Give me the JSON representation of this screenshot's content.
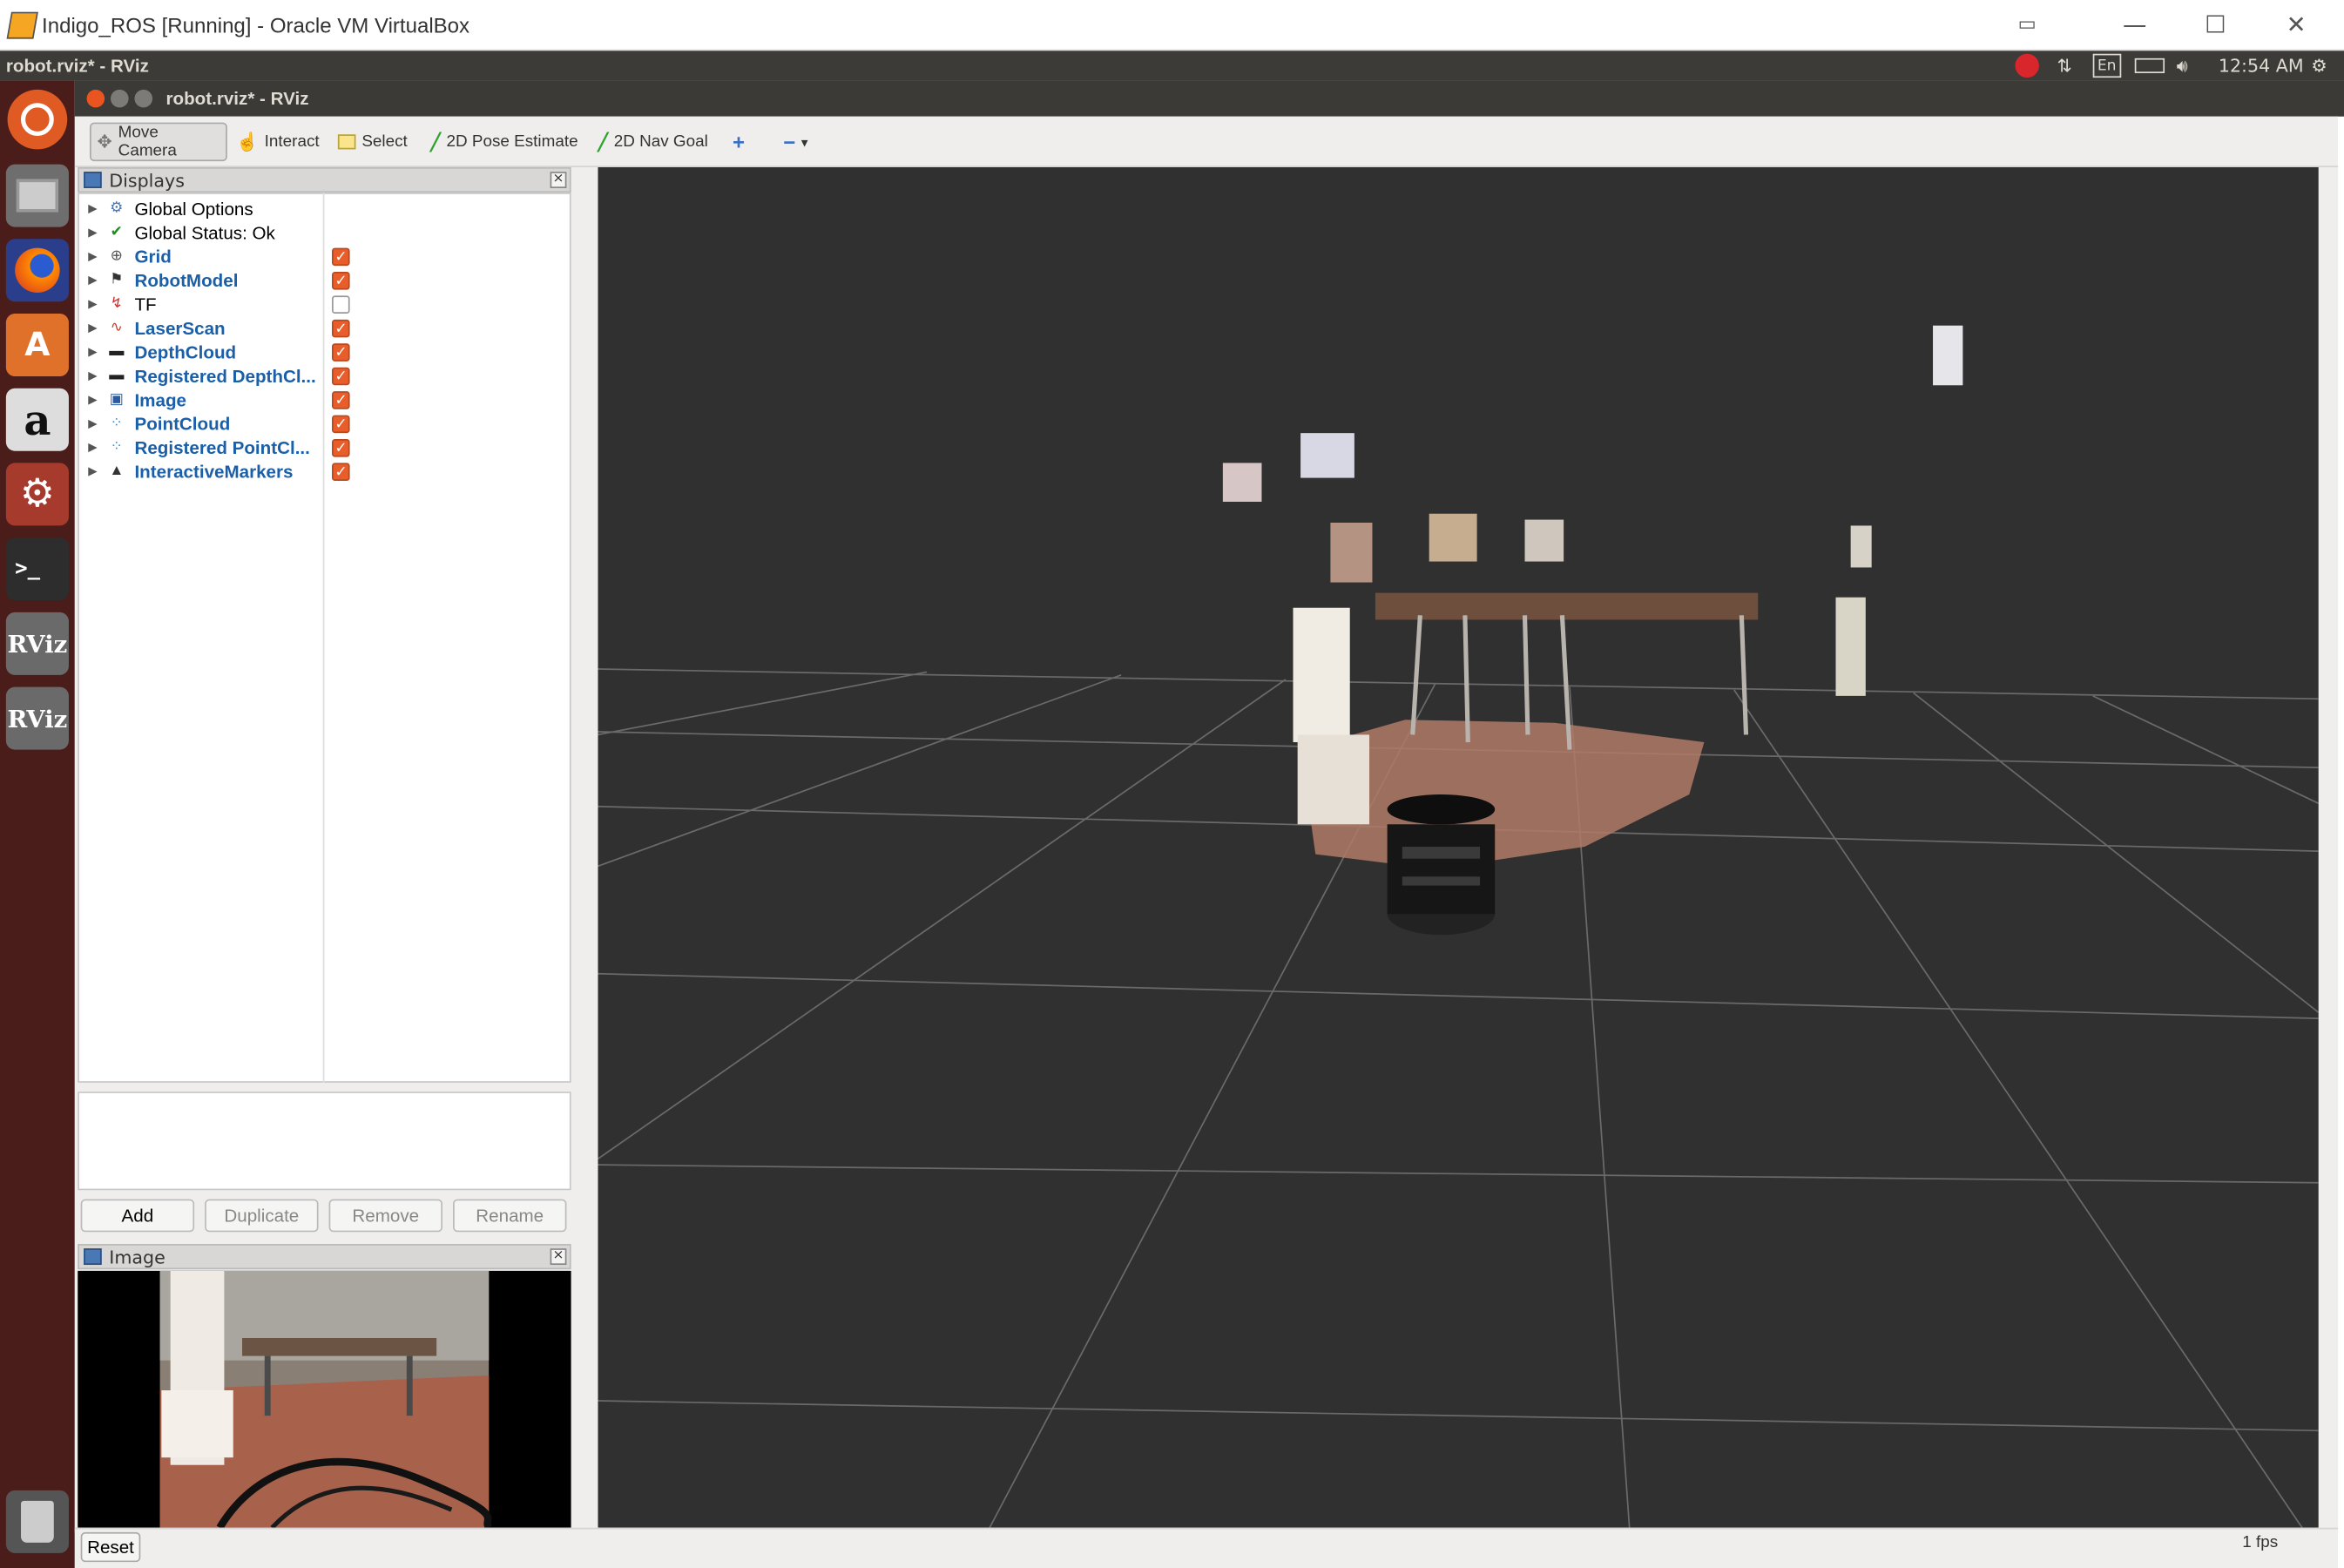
{
  "host_window": {
    "title": "Indigo_ROS [Running] - Oracle VM VirtualBox"
  },
  "top_panel": {
    "app_title": "robot.rviz* - RViz",
    "keyboard": "En",
    "clock": "12:54 AM"
  },
  "launcher": {
    "items": [
      "ubuntu-dash",
      "files",
      "firefox",
      "software-center",
      "amazon",
      "system-settings",
      "terminal",
      "rviz",
      "rviz",
      "trash"
    ],
    "rviz_label": "RViz",
    "amazon_label": "a"
  },
  "rviz": {
    "window_title": "robot.rviz* - RViz"
  },
  "toolbar": {
    "move_camera": "Move Camera",
    "interact": "Interact",
    "select": "Select",
    "pose_estimate": "2D Pose Estimate",
    "nav_goal": "2D Nav Goal"
  },
  "displays": {
    "title": "Displays",
    "items": [
      {
        "label": "Global Options",
        "style": "black",
        "checkbox": null
      },
      {
        "label": "Global Status: Ok",
        "style": "black",
        "checkbox": null
      },
      {
        "label": "Grid",
        "style": "blue",
        "checkbox": true
      },
      {
        "label": "RobotModel",
        "style": "blue",
        "checkbox": true
      },
      {
        "label": "TF",
        "style": "black",
        "checkbox": false
      },
      {
        "label": "LaserScan",
        "style": "blue",
        "checkbox": true
      },
      {
        "label": "DepthCloud",
        "style": "blue",
        "checkbox": true
      },
      {
        "label": "Registered DepthCl...",
        "style": "blue",
        "checkbox": true
      },
      {
        "label": "Image",
        "style": "blue",
        "checkbox": true
      },
      {
        "label": "PointCloud",
        "style": "blue",
        "checkbox": true
      },
      {
        "label": "Registered PointCl...",
        "style": "blue",
        "checkbox": true
      },
      {
        "label": "InteractiveMarkers",
        "style": "blue",
        "checkbox": true
      }
    ],
    "buttons": {
      "add": "Add",
      "duplicate": "Duplicate",
      "remove": "Remove",
      "rename": "Rename"
    }
  },
  "image_panel": {
    "title": "Image"
  },
  "status": {
    "reset": "Reset",
    "fps": "1 fps"
  },
  "colors": {
    "viewport_bg": "#303030",
    "grid": "#6a6a6a",
    "accent_check": "#e85d2a",
    "tree_blue": "#1a5fa8"
  }
}
